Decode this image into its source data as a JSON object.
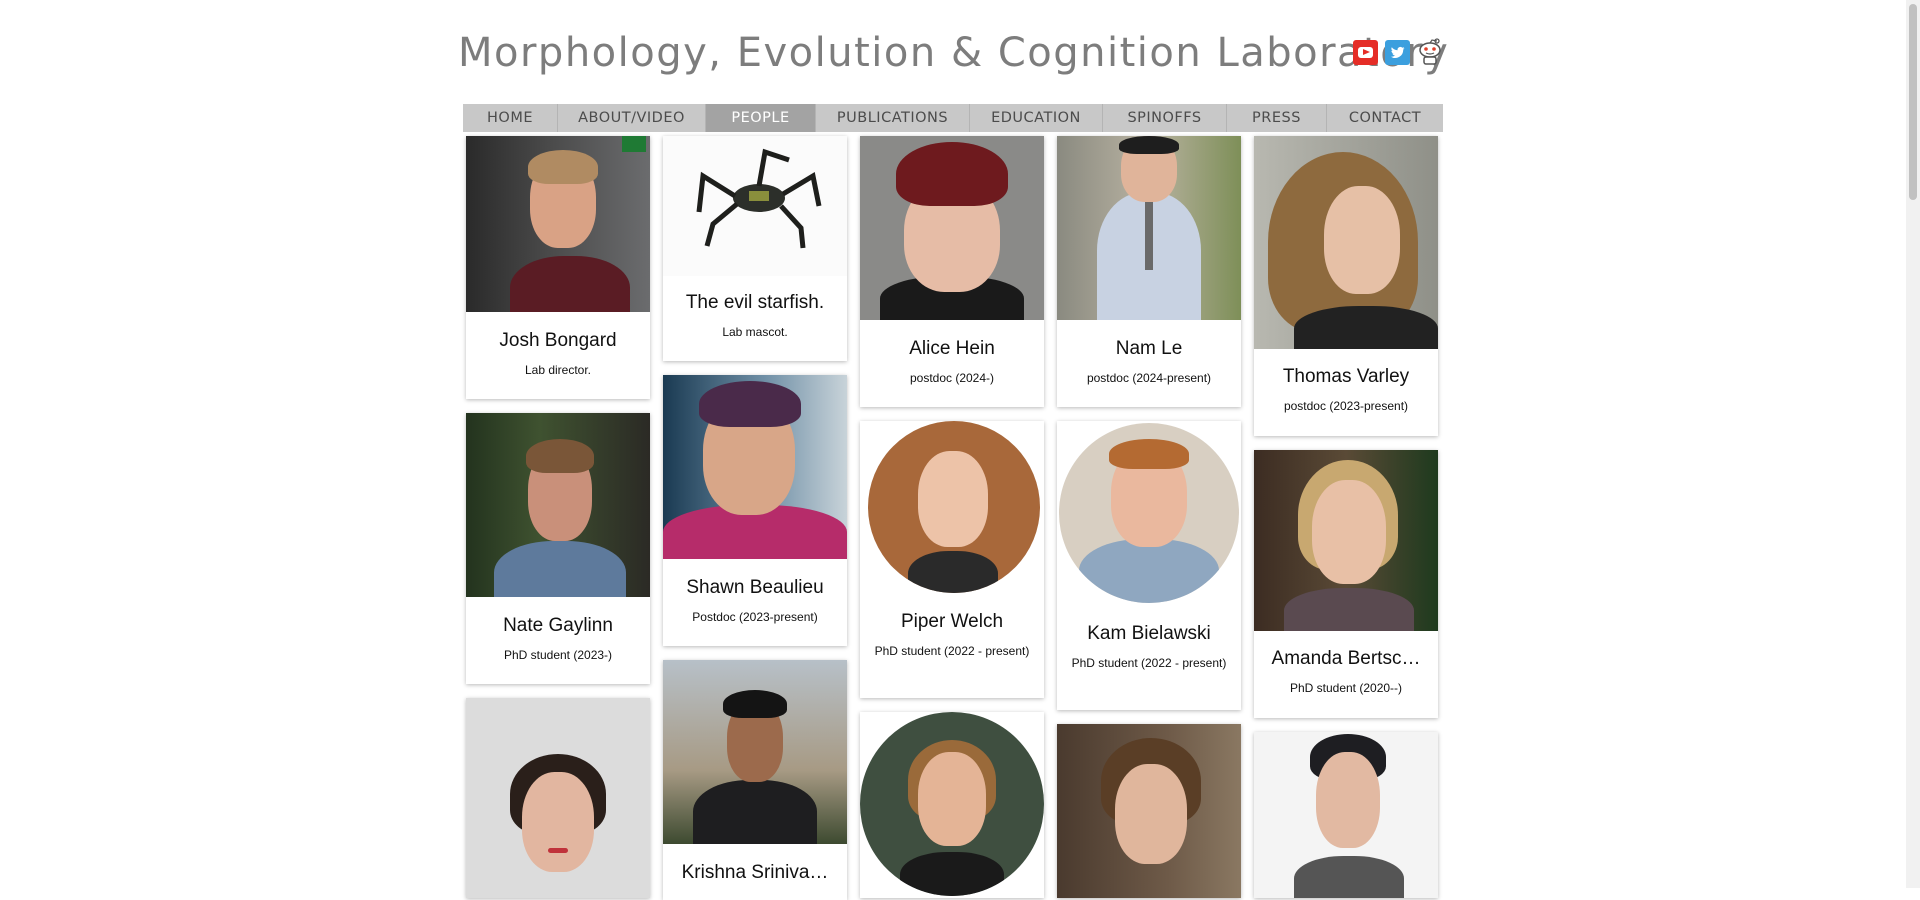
{
  "header": {
    "title": "Morphology, Evolution & Cognition Laboratory"
  },
  "social": [
    "youtube-icon",
    "twitter-icon",
    "reddit-icon"
  ],
  "nav": {
    "items": [
      "HOME",
      "ABOUT/VIDEO",
      "PEOPLE",
      "PUBLICATIONS",
      "EDUCATION",
      "SPINOFFS",
      "PRESS",
      "CONTACT"
    ],
    "active": "PEOPLE"
  },
  "people": [
    {
      "name": "Josh Bongard",
      "role": "Lab director."
    },
    {
      "name": "The evil starfish.",
      "role": "Lab mascot."
    },
    {
      "name": "Alice Hein",
      "role": "postdoc (2024-)"
    },
    {
      "name": "Nam Le",
      "role": "postdoc (2024-present)"
    },
    {
      "name": "Thomas Varley",
      "role": "postdoc (2023-present)"
    },
    {
      "name": "Nate Gaylinn",
      "role": "PhD student (2023-)"
    },
    {
      "name": "Shawn Beaulieu",
      "role": "Postdoc (2023-present)"
    },
    {
      "name": "Piper Welch",
      "role": "PhD student (2022 - present)"
    },
    {
      "name": "Kam Bielawski",
      "role": "PhD student (2022 - present)"
    },
    {
      "name": "Amanda Bertsc…",
      "role": "PhD student (2020--)"
    },
    {
      "name": "",
      "role": ""
    },
    {
      "name": "Krishna Sriniva…",
      "role": ""
    },
    {
      "name": "",
      "role": ""
    },
    {
      "name": "",
      "role": ""
    },
    {
      "name": "",
      "role": ""
    }
  ]
}
